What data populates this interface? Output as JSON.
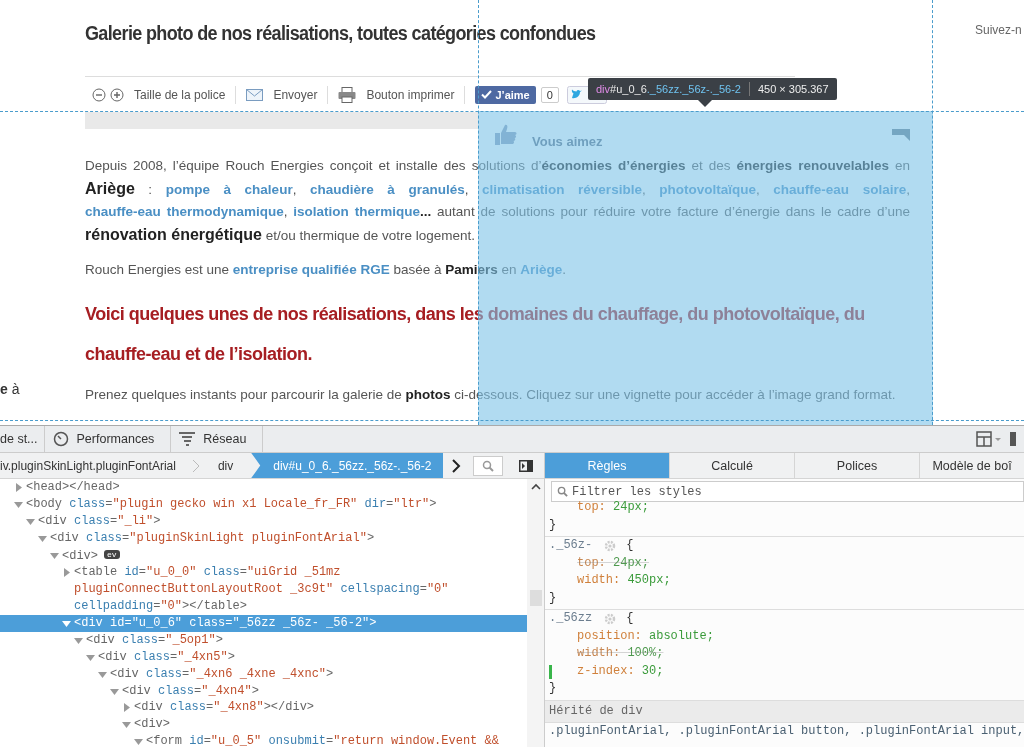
{
  "page": {
    "title": "Galerie photo de nos réalisations, toutes catégories confondues",
    "follow_link": "Suivez-n",
    "sidebar_fragment": "**e** à",
    "share_bar": {
      "items": [
        {
          "kind": "font-size",
          "label": "Taille de la police"
        },
        {
          "kind": "email",
          "label": "Envoyer"
        },
        {
          "kind": "print",
          "label": "Bouton imprimer"
        }
      ],
      "like_button": "J’aime",
      "like_count": "0"
    },
    "like_popup": {
      "label": "Vous aimez"
    },
    "content": [
      {
        "kind": "paragraph",
        "segments": [
          {
            "kind": "text",
            "text": "Depuis 2008, l’équipe Rouch Energies conçoit et installe des solutions d’**économies d’énergies** et des **énergies renouvelables** en "
          },
          {
            "kind": "strong",
            "text": "Ariège"
          },
          {
            "kind": "text",
            "text": " : "
          },
          {
            "kind": "link",
            "text": "pompe à chaleur"
          },
          {
            "kind": "text",
            "text": ", "
          },
          {
            "kind": "link",
            "text": "chaudière à granulés"
          },
          {
            "kind": "text",
            "text": ", "
          },
          {
            "kind": "link",
            "text": "climatisation réversible"
          },
          {
            "kind": "text",
            "text": ", "
          },
          {
            "kind": "link",
            "text": "photovoltaïque"
          },
          {
            "kind": "text",
            "text": ", "
          },
          {
            "kind": "link",
            "text": "chauffe-eau solaire"
          },
          {
            "kind": "text",
            "text": ", "
          },
          {
            "kind": "link",
            "text": "chauffe-eau thermodynamique"
          },
          {
            "kind": "text",
            "text": ", "
          },
          {
            "kind": "link",
            "text": "isolation thermique"
          },
          {
            "kind": "text",
            "text": "**...** autant de solutions pour réduire votre facture d’énergie dans le cadre d’une "
          },
          {
            "kind": "strong",
            "text": "rénovation énergétique"
          },
          {
            "kind": "text",
            "text": " et/ou thermique de votre logement."
          }
        ]
      },
      {
        "kind": "paragraph",
        "segments": [
          {
            "kind": "text",
            "text": "Rouch Energies est une "
          },
          {
            "kind": "link",
            "text": "entreprise qualifiée RGE"
          },
          {
            "kind": "text",
            "text": " basée à **Pamiers** en "
          },
          {
            "kind": "link",
            "text": "Ariège"
          },
          {
            "kind": "text",
            "text": "."
          }
        ]
      },
      {
        "kind": "heading",
        "text": "Voici quelques unes de nos réalisations, dans les domaines du chauffage, du photovoltaïque, du chauffe-eau et de l’isolation."
      },
      {
        "kind": "paragraph",
        "segments": [
          {
            "kind": "text",
            "text": "Prenez quelques instants pour parcourir la galerie de **photos** ci-dessous. Cliquez sur une vignette pour accéder à l’image grand format."
          }
        ]
      }
    ]
  },
  "inspector_highlight": {
    "tag": "div",
    "id": "#u_0_6",
    "classes": "._56zz._56z-._56-2",
    "size": "450 × 305.367"
  },
  "devtools": {
    "tools": [
      {
        "kind": "plain",
        "label": "de st..."
      },
      {
        "kind": "performance",
        "label": "Performances"
      },
      {
        "kind": "network",
        "label": "Réseau"
      }
    ],
    "breadcrumbs": [
      {
        "label": "iv.pluginSkinLight.pluginFontArial",
        "selected": false
      },
      {
        "label": "div",
        "selected": false
      },
      {
        "label": "div#u_0_6._56zz._56z-._56-2",
        "selected": true
      }
    ],
    "markup": [
      {
        "expanded": false,
        "selected": false,
        "tokens": [
          {
            "kind": "tag",
            "text": "<head></head>"
          }
        ]
      },
      {
        "expanded": true,
        "selected": false,
        "tokens": [
          {
            "kind": "tag",
            "text": "<body"
          },
          {
            "kind": "attr",
            "text": " class"
          },
          {
            "kind": "tag",
            "text": "="
          },
          {
            "kind": "value",
            "text": "\"plugin gecko win x1 Locale_fr_FR\""
          },
          {
            "kind": "attr",
            "text": " dir"
          },
          {
            "kind": "tag",
            "text": "="
          },
          {
            "kind": "value",
            "text": "\"ltr\""
          },
          {
            "kind": "tag",
            "text": ">"
          }
        ],
        "children": [
          {
            "expanded": true,
            "selected": false,
            "tokens": [
              {
                "kind": "tag",
                "text": "<div"
              },
              {
                "kind": "attr",
                "text": " class"
              },
              {
                "kind": "tag",
                "text": "="
              },
              {
                "kind": "value",
                "text": "\"_li\""
              },
              {
                "kind": "tag",
                "text": ">"
              }
            ],
            "children": [
              {
                "expanded": true,
                "selected": false,
                "tokens": [
                  {
                    "kind": "tag",
                    "text": "<div"
                  },
                  {
                    "kind": "attr",
                    "text": " class"
                  },
                  {
                    "kind": "tag",
                    "text": "="
                  },
                  {
                    "kind": "value",
                    "text": "\"pluginSkinLight pluginFontArial\""
                  },
                  {
                    "kind": "tag",
                    "text": ">"
                  }
                ],
                "children": [
                  {
                    "expanded": true,
                    "selected": false,
                    "badge": "ev",
                    "tokens": [
                      {
                        "kind": "tag",
                        "text": "<div>"
                      }
                    ],
                    "children": [
                      {
                        "expanded": false,
                        "selected": false,
                        "tokens": [
                          {
                            "kind": "tag",
                            "text": "<table"
                          },
                          {
                            "kind": "attr",
                            "text": " id"
                          },
                          {
                            "kind": "tag",
                            "text": "="
                          },
                          {
                            "kind": "value",
                            "text": "\"u_0_0\""
                          },
                          {
                            "kind": "attr",
                            "text": " class"
                          },
                          {
                            "kind": "tag",
                            "text": "="
                          },
                          {
                            "kind": "value",
                            "text": "\"uiGrid _51mz pluginConnectButtonLayoutRoot _3c9t\""
                          },
                          {
                            "kind": "attr",
                            "text": " cellspacing"
                          },
                          {
                            "kind": "tag",
                            "text": "="
                          },
                          {
                            "kind": "value",
                            "text": "\"0\""
                          },
                          {
                            "kind": "attr",
                            "text": " cellpadding"
                          },
                          {
                            "kind": "tag",
                            "text": "="
                          },
                          {
                            "kind": "value",
                            "text": "\"0\""
                          },
                          {
                            "kind": "tag",
                            "text": "></table>"
                          }
                        ]
                      },
                      {
                        "expanded": true,
                        "selected": true,
                        "tokens": [
                          {
                            "kind": "tag",
                            "text": "<div"
                          },
                          {
                            "kind": "attr",
                            "text": " id"
                          },
                          {
                            "kind": "tag",
                            "text": "="
                          },
                          {
                            "kind": "value",
                            "text": "\"u_0_6\""
                          },
                          {
                            "kind": "attr",
                            "text": " class"
                          },
                          {
                            "kind": "tag",
                            "text": "="
                          },
                          {
                            "kind": "value",
                            "text": "\"_56zz _56z- _56-2\""
                          },
                          {
                            "kind": "tag",
                            "text": ">"
                          }
                        ],
                        "children": [
                          {
                            "expanded": true,
                            "selected": false,
                            "tokens": [
                              {
                                "kind": "tag",
                                "text": "<div"
                              },
                              {
                                "kind": "attr",
                                "text": " class"
                              },
                              {
                                "kind": "tag",
                                "text": "="
                              },
                              {
                                "kind": "value",
                                "text": "\"_5op1\""
                              },
                              {
                                "kind": "tag",
                                "text": ">"
                              }
                            ],
                            "children": [
                              {
                                "expanded": true,
                                "selected": false,
                                "tokens": [
                                  {
                                    "kind": "tag",
                                    "text": "<div"
                                  },
                                  {
                                    "kind": "attr",
                                    "text": " class"
                                  },
                                  {
                                    "kind": "tag",
                                    "text": "="
                                  },
                                  {
                                    "kind": "value",
                                    "text": "\"_4xn5\""
                                  },
                                  {
                                    "kind": "tag",
                                    "text": ">"
                                  }
                                ],
                                "children": [
                                  {
                                    "expanded": true,
                                    "selected": false,
                                    "tokens": [
                                      {
                                        "kind": "tag",
                                        "text": "<div"
                                      },
                                      {
                                        "kind": "attr",
                                        "text": " class"
                                      },
                                      {
                                        "kind": "tag",
                                        "text": "="
                                      },
                                      {
                                        "kind": "value",
                                        "text": "\"_4xn6 _4xne _4xnc\""
                                      },
                                      {
                                        "kind": "tag",
                                        "text": ">"
                                      }
                                    ],
                                    "children": [
                                      {
                                        "expanded": true,
                                        "selected": false,
                                        "tokens": [
                                          {
                                            "kind": "tag",
                                            "text": "<div"
                                          },
                                          {
                                            "kind": "attr",
                                            "text": " class"
                                          },
                                          {
                                            "kind": "tag",
                                            "text": "="
                                          },
                                          {
                                            "kind": "value",
                                            "text": "\"_4xn4\""
                                          },
                                          {
                                            "kind": "tag",
                                            "text": ">"
                                          }
                                        ],
                                        "children": [
                                          {
                                            "expanded": false,
                                            "selected": false,
                                            "tokens": [
                                              {
                                                "kind": "tag",
                                                "text": "<div"
                                              },
                                              {
                                                "kind": "attr",
                                                "text": " class"
                                              },
                                              {
                                                "kind": "tag",
                                                "text": "="
                                              },
                                              {
                                                "kind": "value",
                                                "text": "\"_4xn8\""
                                              },
                                              {
                                                "kind": "tag",
                                                "text": "></div>"
                                              }
                                            ]
                                          },
                                          {
                                            "expanded": true,
                                            "selected": false,
                                            "tokens": [
                                              {
                                                "kind": "tag",
                                                "text": "<div>"
                                              }
                                            ],
                                            "children": [
                                              {
                                                "expanded": true,
                                                "selected": false,
                                                "tokens": [
                                                  {
                                                    "kind": "tag",
                                                    "text": "<form"
                                                  },
                                                  {
                                                    "kind": "attr",
                                                    "text": " id"
                                                  },
                                                  {
                                                    "kind": "tag",
                                                    "text": "="
                                                  },
                                                  {
                                                    "kind": "value",
                                                    "text": "\"u_0_5\""
                                                  },
                                                  {
                                                    "kind": "attr",
                                                    "text": " onsubmit"
                                                  },
                                                  {
                                                    "kind": "tag",
                                                    "text": "="
                                                  },
                                                  {
                                                    "kind": "value",
                                                    "text": "\"return window.Event &&"
                                                  }
                                                ]
                                              }
                                            ]
                                          }
                                        ]
                                      }
                                    ]
                                  }
                                ]
                              }
                            ]
                          }
                        ]
                      }
                    ]
                  }
                ]
              }
            ]
          }
        ]
      }
    ],
    "sidebar_tabs": [
      {
        "label": "Règles",
        "selected": true
      },
      {
        "label": "Calculé",
        "selected": false
      },
      {
        "label": "Polices",
        "selected": false
      },
      {
        "label": "Modèle de boî",
        "selected": false
      }
    ],
    "filter_placeholder": "Filtrer les styles",
    "rules": [
      {
        "close_brace": "}",
        "declarations": [
          {
            "name": "top:",
            "value": "24px;",
            "overridden": false,
            "changed": false
          }
        ]
      },
      {
        "selector": "._56z-",
        "open_brace": "{",
        "close_brace": "}",
        "declarations": [
          {
            "name": "top:",
            "value": "24px;",
            "overridden": true,
            "changed": false
          },
          {
            "name": "width:",
            "value": "450px;",
            "overridden": false,
            "changed": false
          }
        ]
      },
      {
        "selector": "._56zz",
        "open_brace": "{",
        "close_brace": "}",
        "declarations": [
          {
            "name": "position:",
            "value": "absolute;",
            "overridden": false,
            "changed": false
          },
          {
            "name": "width:",
            "value": "100%;",
            "overridden": true,
            "changed": false
          },
          {
            "name": "z-index:",
            "value": "30;",
            "overridden": false,
            "changed": true
          }
        ]
      }
    ],
    "inherited_header": "Hérité de div",
    "inherited_selector": ".pluginFontArial, .pluginFontArial button, .pluginFontArial input,"
  }
}
